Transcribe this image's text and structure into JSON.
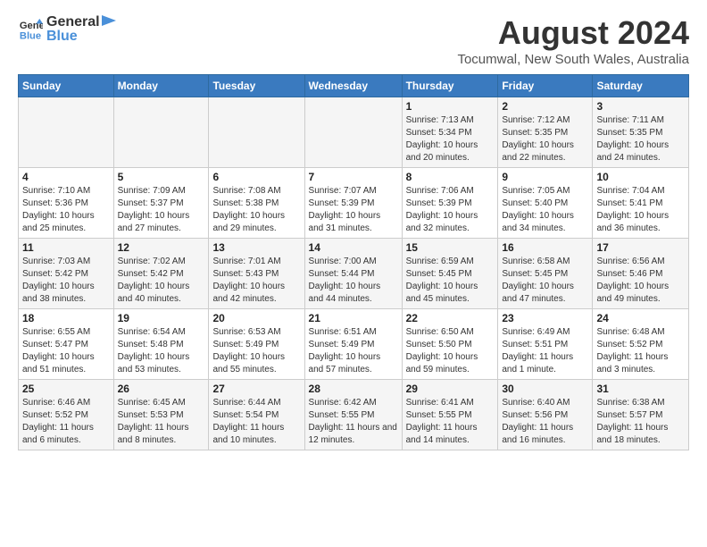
{
  "logo": {
    "line1": "General",
    "line2": "Blue"
  },
  "title": "August 2024",
  "subtitle": "Tocumwal, New South Wales, Australia",
  "days_of_week": [
    "Sunday",
    "Monday",
    "Tuesday",
    "Wednesday",
    "Thursday",
    "Friday",
    "Saturday"
  ],
  "weeks": [
    [
      {
        "day": "",
        "sunrise": "",
        "sunset": "",
        "daylight": ""
      },
      {
        "day": "",
        "sunrise": "",
        "sunset": "",
        "daylight": ""
      },
      {
        "day": "",
        "sunrise": "",
        "sunset": "",
        "daylight": ""
      },
      {
        "day": "",
        "sunrise": "",
        "sunset": "",
        "daylight": ""
      },
      {
        "day": "1",
        "sunrise": "Sunrise: 7:13 AM",
        "sunset": "Sunset: 5:34 PM",
        "daylight": "Daylight: 10 hours and 20 minutes."
      },
      {
        "day": "2",
        "sunrise": "Sunrise: 7:12 AM",
        "sunset": "Sunset: 5:35 PM",
        "daylight": "Daylight: 10 hours and 22 minutes."
      },
      {
        "day": "3",
        "sunrise": "Sunrise: 7:11 AM",
        "sunset": "Sunset: 5:35 PM",
        "daylight": "Daylight: 10 hours and 24 minutes."
      }
    ],
    [
      {
        "day": "4",
        "sunrise": "Sunrise: 7:10 AM",
        "sunset": "Sunset: 5:36 PM",
        "daylight": "Daylight: 10 hours and 25 minutes."
      },
      {
        "day": "5",
        "sunrise": "Sunrise: 7:09 AM",
        "sunset": "Sunset: 5:37 PM",
        "daylight": "Daylight: 10 hours and 27 minutes."
      },
      {
        "day": "6",
        "sunrise": "Sunrise: 7:08 AM",
        "sunset": "Sunset: 5:38 PM",
        "daylight": "Daylight: 10 hours and 29 minutes."
      },
      {
        "day": "7",
        "sunrise": "Sunrise: 7:07 AM",
        "sunset": "Sunset: 5:39 PM",
        "daylight": "Daylight: 10 hours and 31 minutes."
      },
      {
        "day": "8",
        "sunrise": "Sunrise: 7:06 AM",
        "sunset": "Sunset: 5:39 PM",
        "daylight": "Daylight: 10 hours and 32 minutes."
      },
      {
        "day": "9",
        "sunrise": "Sunrise: 7:05 AM",
        "sunset": "Sunset: 5:40 PM",
        "daylight": "Daylight: 10 hours and 34 minutes."
      },
      {
        "day": "10",
        "sunrise": "Sunrise: 7:04 AM",
        "sunset": "Sunset: 5:41 PM",
        "daylight": "Daylight: 10 hours and 36 minutes."
      }
    ],
    [
      {
        "day": "11",
        "sunrise": "Sunrise: 7:03 AM",
        "sunset": "Sunset: 5:42 PM",
        "daylight": "Daylight: 10 hours and 38 minutes."
      },
      {
        "day": "12",
        "sunrise": "Sunrise: 7:02 AM",
        "sunset": "Sunset: 5:42 PM",
        "daylight": "Daylight: 10 hours and 40 minutes."
      },
      {
        "day": "13",
        "sunrise": "Sunrise: 7:01 AM",
        "sunset": "Sunset: 5:43 PM",
        "daylight": "Daylight: 10 hours and 42 minutes."
      },
      {
        "day": "14",
        "sunrise": "Sunrise: 7:00 AM",
        "sunset": "Sunset: 5:44 PM",
        "daylight": "Daylight: 10 hours and 44 minutes."
      },
      {
        "day": "15",
        "sunrise": "Sunrise: 6:59 AM",
        "sunset": "Sunset: 5:45 PM",
        "daylight": "Daylight: 10 hours and 45 minutes."
      },
      {
        "day": "16",
        "sunrise": "Sunrise: 6:58 AM",
        "sunset": "Sunset: 5:45 PM",
        "daylight": "Daylight: 10 hours and 47 minutes."
      },
      {
        "day": "17",
        "sunrise": "Sunrise: 6:56 AM",
        "sunset": "Sunset: 5:46 PM",
        "daylight": "Daylight: 10 hours and 49 minutes."
      }
    ],
    [
      {
        "day": "18",
        "sunrise": "Sunrise: 6:55 AM",
        "sunset": "Sunset: 5:47 PM",
        "daylight": "Daylight: 10 hours and 51 minutes."
      },
      {
        "day": "19",
        "sunrise": "Sunrise: 6:54 AM",
        "sunset": "Sunset: 5:48 PM",
        "daylight": "Daylight: 10 hours and 53 minutes."
      },
      {
        "day": "20",
        "sunrise": "Sunrise: 6:53 AM",
        "sunset": "Sunset: 5:49 PM",
        "daylight": "Daylight: 10 hours and 55 minutes."
      },
      {
        "day": "21",
        "sunrise": "Sunrise: 6:51 AM",
        "sunset": "Sunset: 5:49 PM",
        "daylight": "Daylight: 10 hours and 57 minutes."
      },
      {
        "day": "22",
        "sunrise": "Sunrise: 6:50 AM",
        "sunset": "Sunset: 5:50 PM",
        "daylight": "Daylight: 10 hours and 59 minutes."
      },
      {
        "day": "23",
        "sunrise": "Sunrise: 6:49 AM",
        "sunset": "Sunset: 5:51 PM",
        "daylight": "Daylight: 11 hours and 1 minute."
      },
      {
        "day": "24",
        "sunrise": "Sunrise: 6:48 AM",
        "sunset": "Sunset: 5:52 PM",
        "daylight": "Daylight: 11 hours and 3 minutes."
      }
    ],
    [
      {
        "day": "25",
        "sunrise": "Sunrise: 6:46 AM",
        "sunset": "Sunset: 5:52 PM",
        "daylight": "Daylight: 11 hours and 6 minutes."
      },
      {
        "day": "26",
        "sunrise": "Sunrise: 6:45 AM",
        "sunset": "Sunset: 5:53 PM",
        "daylight": "Daylight: 11 hours and 8 minutes."
      },
      {
        "day": "27",
        "sunrise": "Sunrise: 6:44 AM",
        "sunset": "Sunset: 5:54 PM",
        "daylight": "Daylight: 11 hours and 10 minutes."
      },
      {
        "day": "28",
        "sunrise": "Sunrise: 6:42 AM",
        "sunset": "Sunset: 5:55 PM",
        "daylight": "Daylight: 11 hours and 12 minutes."
      },
      {
        "day": "29",
        "sunrise": "Sunrise: 6:41 AM",
        "sunset": "Sunset: 5:55 PM",
        "daylight": "Daylight: 11 hours and 14 minutes."
      },
      {
        "day": "30",
        "sunrise": "Sunrise: 6:40 AM",
        "sunset": "Sunset: 5:56 PM",
        "daylight": "Daylight: 11 hours and 16 minutes."
      },
      {
        "day": "31",
        "sunrise": "Sunrise: 6:38 AM",
        "sunset": "Sunset: 5:57 PM",
        "daylight": "Daylight: 11 hours and 18 minutes."
      }
    ]
  ]
}
